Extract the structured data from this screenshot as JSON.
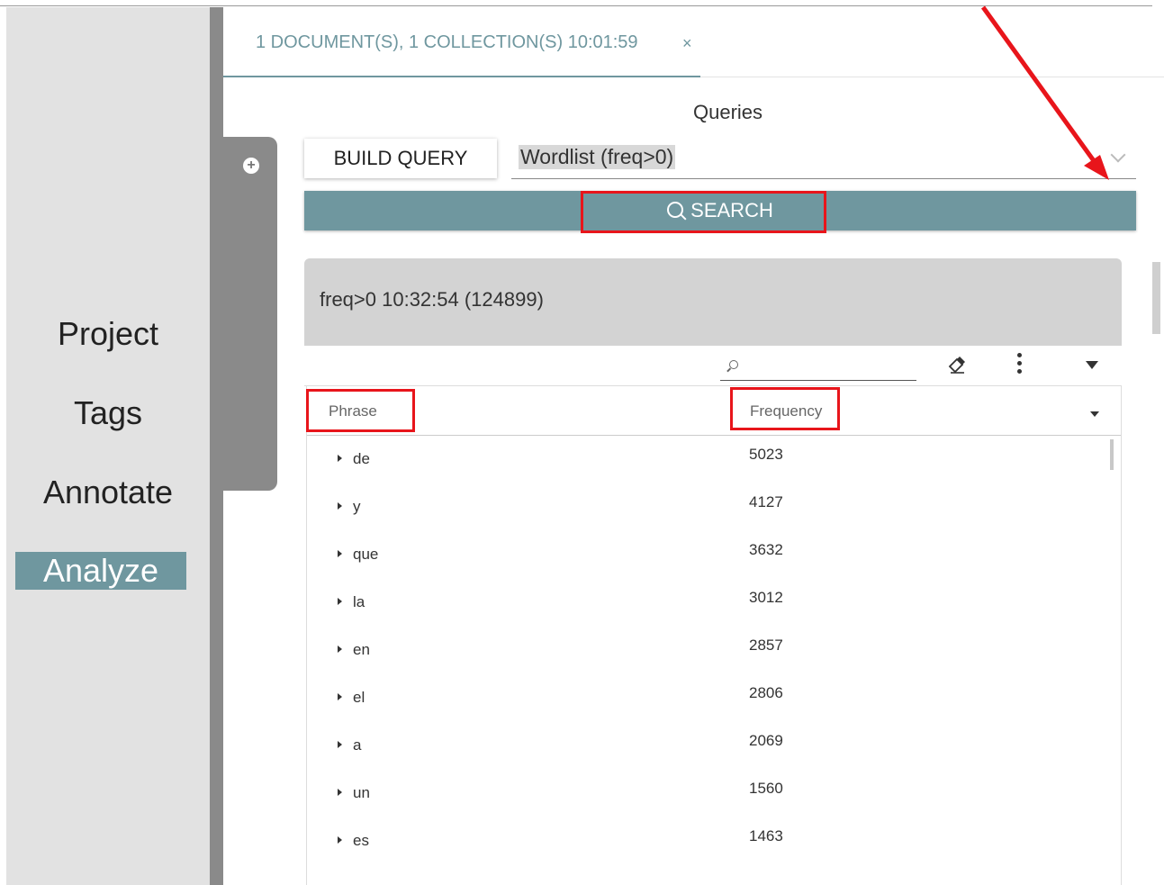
{
  "nav": {
    "items": [
      {
        "label": "Project"
      },
      {
        "label": "Tags"
      },
      {
        "label": "Annotate"
      },
      {
        "label": "Analyze"
      }
    ],
    "active": "Analyze"
  },
  "doc_tab": {
    "label": "1 DOCUMENT(S), 1 COLLECTION(S) 10:01:59",
    "close": "×"
  },
  "queries": {
    "title": "Queries",
    "build_query": "BUILD QUERY",
    "selected_query": "Wordlist (freq>0)",
    "search": "SEARCH"
  },
  "result": {
    "title": "freq>0 10:32:54 (124899)",
    "columns": {
      "phrase": "Phrase",
      "frequency": "Frequency"
    },
    "rows": [
      {
        "phrase": "de",
        "freq": "5023"
      },
      {
        "phrase": "y",
        "freq": "4127"
      },
      {
        "phrase": "que",
        "freq": "3632"
      },
      {
        "phrase": "la",
        "freq": "3012"
      },
      {
        "phrase": "en",
        "freq": "2857"
      },
      {
        "phrase": "el",
        "freq": "2806"
      },
      {
        "phrase": "a",
        "freq": "2069"
      },
      {
        "phrase": "un",
        "freq": "1560"
      },
      {
        "phrase": "es",
        "freq": "1463"
      }
    ]
  },
  "colors": {
    "accent": "#6f979f",
    "highlight": "#e8151b"
  }
}
